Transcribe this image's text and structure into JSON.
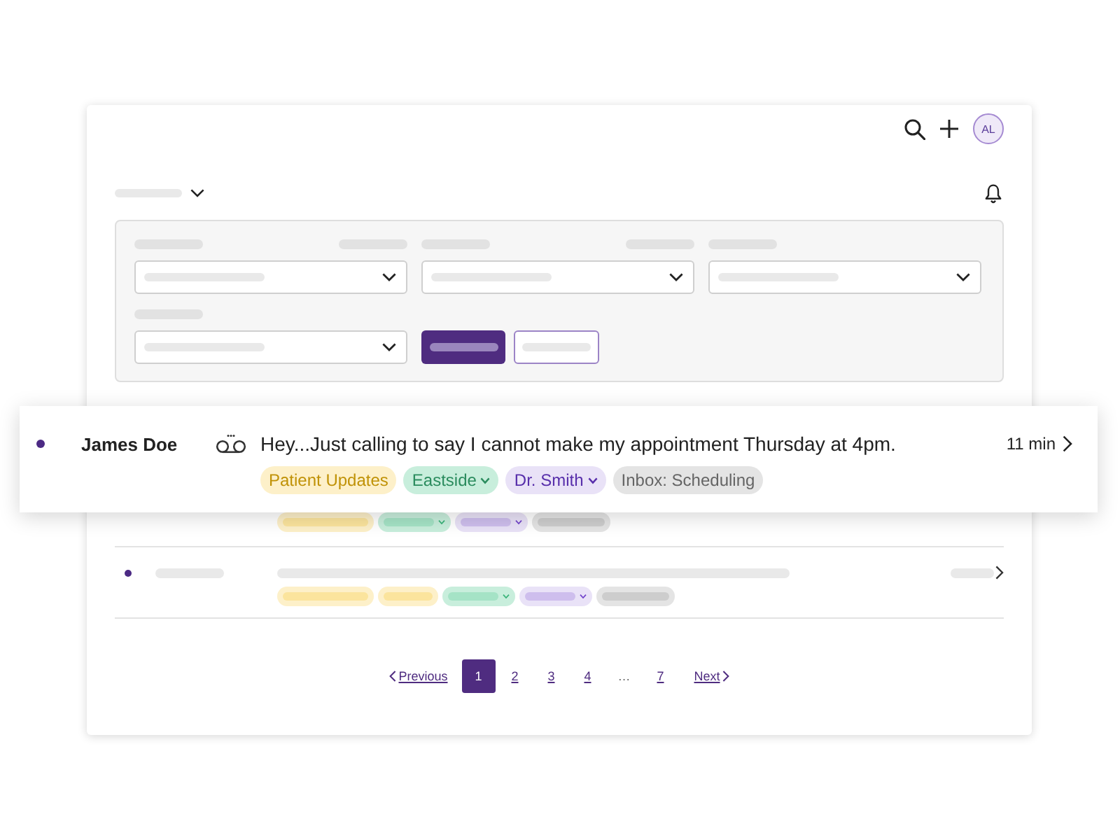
{
  "header": {
    "avatar": "AL"
  },
  "highlighted_message": {
    "unread": true,
    "sender": "James Doe",
    "preview": "Hey...Just calling to say I cannot make my appointment Thursday at 4pm.",
    "time": "11 min",
    "tags": [
      {
        "label": "Patient Updates",
        "color": "#fdf0c9",
        "dropdown": false
      },
      {
        "label": "Eastside",
        "color": "#c8eedc",
        "dropdown": true
      },
      {
        "label": "Dr. Smith",
        "color": "#e9e2f7",
        "dropdown": true
      },
      {
        "label": "Inbox: Scheduling",
        "color": "#e4e4e4",
        "dropdown": false
      }
    ]
  },
  "covered_row": {
    "tags": [
      {
        "color": "#fdf0c9",
        "dropdown": false
      },
      {
        "color": "#c8eedc",
        "dropdown": true
      },
      {
        "color": "#e9e2f7",
        "dropdown": true
      },
      {
        "color": "#e4e4e4",
        "dropdown": false
      }
    ]
  },
  "placeholder_rows": [
    {
      "unread": true,
      "tags": [
        {
          "color": "#fdf0c9",
          "dropdown": false
        },
        {
          "color": "#fdf0c9",
          "dropdown": false
        },
        {
          "color": "#c8eedc",
          "dropdown": true
        },
        {
          "color": "#e9e2f7",
          "dropdown": true
        },
        {
          "color": "#e4e4e4",
          "dropdown": false
        }
      ]
    }
  ],
  "pagination": {
    "previous": "Previous",
    "pages": [
      {
        "kind": "page",
        "label": "1",
        "selected": true
      },
      {
        "kind": "page",
        "label": "2",
        "selected": false
      },
      {
        "kind": "page",
        "label": "3",
        "selected": false
      },
      {
        "kind": "page",
        "label": "4",
        "selected": false
      },
      {
        "kind": "gap",
        "label": "…",
        "selected": false
      },
      {
        "kind": "page",
        "label": "7",
        "selected": false
      }
    ],
    "next": "Next"
  }
}
